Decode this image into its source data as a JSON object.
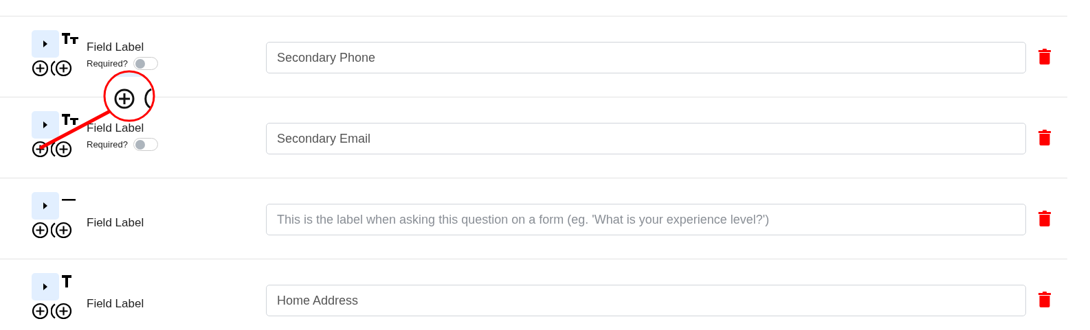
{
  "fields": [
    {
      "kind": "text_height",
      "label": "Field Label",
      "required_label": "Required?",
      "required": false,
      "value": "Secondary Phone"
    },
    {
      "kind": "text_height",
      "label": "Field Label",
      "required_label": "Required?",
      "required": false,
      "value": "Secondary Email"
    },
    {
      "kind": "divider",
      "label": "Field Label",
      "placeholder": "This is the label when asking this question on a form (eg. 'What is your experience level?')"
    },
    {
      "kind": "text",
      "label": "Field Label",
      "value": "Home Address"
    }
  ]
}
